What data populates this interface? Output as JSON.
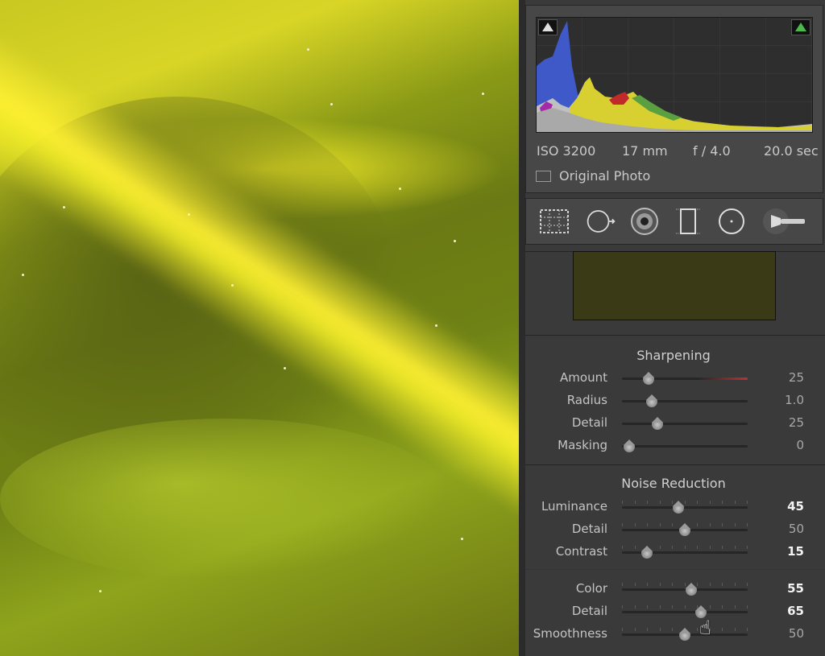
{
  "histogram": {
    "iso": "ISO 3200",
    "focal": "17 mm",
    "aperture": "f / 4.0",
    "shutter": "20.0 sec",
    "original_photo_label": "Original Photo"
  },
  "toolstrip": [
    "crop-overlay-icon",
    "spot-removal-icon",
    "red-eye-icon",
    "graduated-filter-icon",
    "radial-filter-icon",
    "adjustment-brush-icon"
  ],
  "sharpening": {
    "title": "Sharpening",
    "rows": [
      {
        "label": "Amount",
        "value": "25",
        "pos": 0.21
      },
      {
        "label": "Radius",
        "value": "1.0",
        "pos": 0.24
      },
      {
        "label": "Detail",
        "value": "25",
        "pos": 0.28
      },
      {
        "label": "Masking",
        "value": "0",
        "pos": 0.06
      }
    ]
  },
  "noise_reduction": {
    "title": "Noise Reduction",
    "luminance_rows": [
      {
        "label": "Luminance",
        "value": "45",
        "pos": 0.45,
        "bright": true
      },
      {
        "label": "Detail",
        "value": "50",
        "pos": 0.5,
        "bright": false
      },
      {
        "label": "Contrast",
        "value": "15",
        "pos": 0.2,
        "bright": true
      }
    ],
    "color_rows": [
      {
        "label": "Color",
        "value": "55",
        "pos": 0.55,
        "bright": true
      },
      {
        "label": "Detail",
        "value": "65",
        "pos": 0.63,
        "bright": true
      },
      {
        "label": "Smoothness",
        "value": "50",
        "pos": 0.5,
        "bright": false
      }
    ]
  },
  "colors": {
    "panel": "#3a3a3a",
    "accent_red": "#c03030"
  }
}
